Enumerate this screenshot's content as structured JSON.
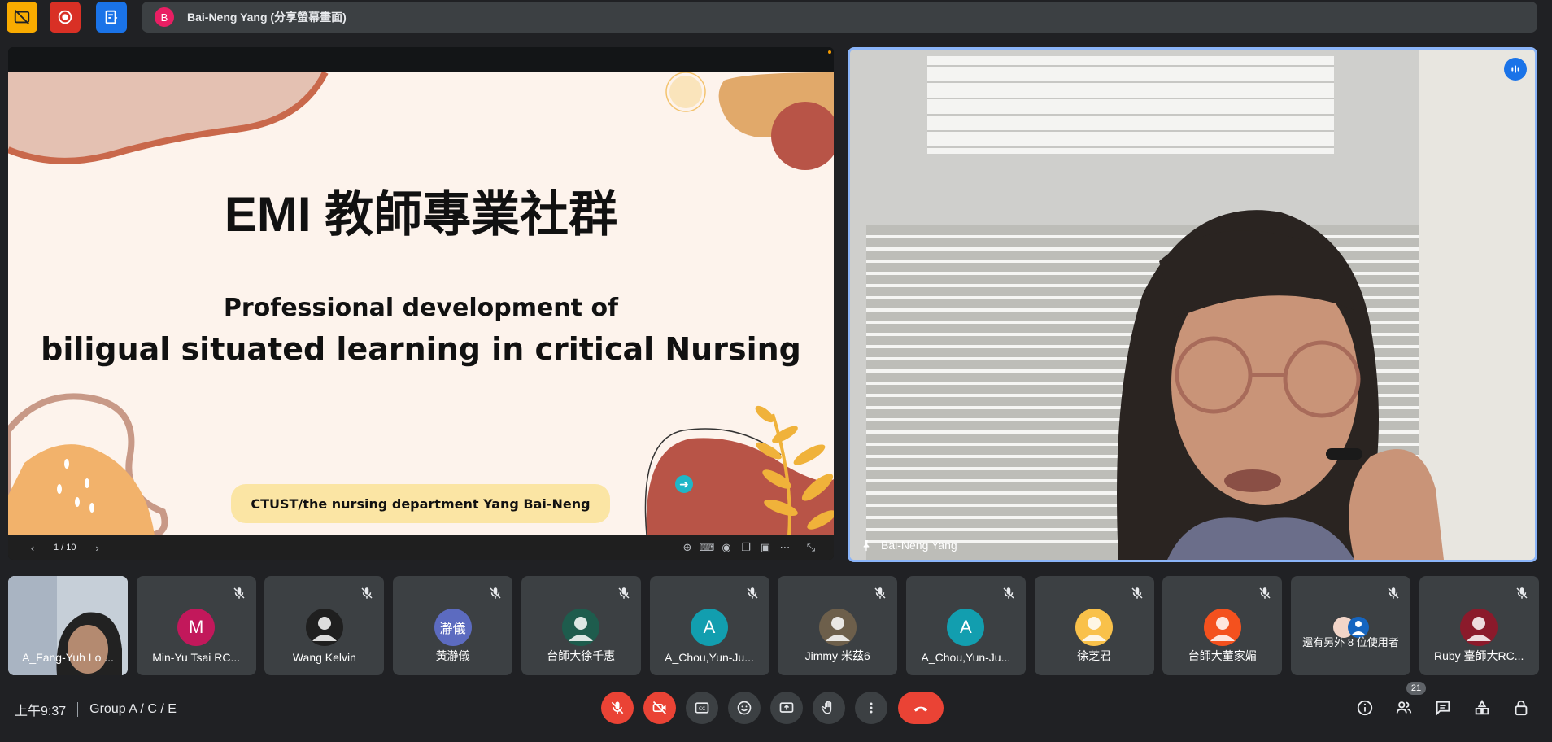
{
  "top_bar": {
    "presenter_initial": "B",
    "presenter_title": "Bai-Neng Yang (分享螢幕畫面)"
  },
  "presentation": {
    "slide_title": "EMI 教師專業社群",
    "slide_subtitle_1": "Professional development of",
    "slide_subtitle_2": "biligual situated learning in critical Nursing",
    "slide_footer": "CTUST/the nursing department Yang Bai-Neng",
    "page_indicator": "1 / 10"
  },
  "speaker": {
    "name": "Bai-Neng Yang"
  },
  "participants": [
    {
      "name": "A_Fang-Yuh Lo ...",
      "initial": "",
      "color": "#8a9bb0",
      "video": true
    },
    {
      "name": "Min-Yu Tsai RC...",
      "initial": "M",
      "color": "#c2185b"
    },
    {
      "name": "Wang Kelvin",
      "initial": "",
      "color": "#1f1f1f"
    },
    {
      "name": "黃瀞儀",
      "initial": "瀞儀",
      "color": "#5c6bc0"
    },
    {
      "name": "台師大徐千惠",
      "initial": "",
      "color": "#1e5c4d"
    },
    {
      "name": "A_Chou,Yun-Ju...",
      "initial": "A",
      "color": "#129eaf"
    },
    {
      "name": "Jimmy 米茲6",
      "initial": "",
      "color": "#6d5f4b"
    },
    {
      "name": "A_Chou,Yun-Ju...",
      "initial": "A",
      "color": "#129eaf"
    },
    {
      "name": "徐芝君",
      "initial": "",
      "color": "#f9c14a"
    },
    {
      "name": "台師大董家媚",
      "initial": "",
      "color": "#f4511e"
    },
    {
      "name": "還有另外 8 位使用者",
      "initial": "",
      "color": "#3c4043"
    },
    {
      "name": "Ruby 臺師大RC...",
      "initial": "",
      "color": "#8b1a2b"
    }
  ],
  "bottom_bar": {
    "time": "上午9:37",
    "meeting_name": "Group A / C / E",
    "people_count": "21"
  }
}
